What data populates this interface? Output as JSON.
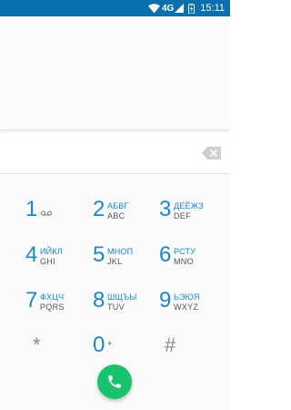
{
  "status_bar": {
    "network": "4G",
    "time": "15:11",
    "color": "#0a6fad",
    "icons": [
      "wifi-icon",
      "signal-icon",
      "battery-icon"
    ]
  },
  "dialpad": {
    "number": "",
    "accent_color": "#1a87c9",
    "call_button_color": "#19c36e",
    "keys": [
      {
        "digit": "1",
        "cyr": "",
        "lat": "",
        "icon": "voicemail-icon"
      },
      {
        "digit": "2",
        "cyr": "АБВГ",
        "lat": "ABC"
      },
      {
        "digit": "3",
        "cyr": "ДЕЁЖЗ",
        "lat": "DEF"
      },
      {
        "digit": "4",
        "cyr": "ИЙКЛ",
        "lat": "GHI"
      },
      {
        "digit": "5",
        "cyr": "МНОП",
        "lat": "JKL"
      },
      {
        "digit": "6",
        "cyr": "РСТУ",
        "lat": "MNO"
      },
      {
        "digit": "7",
        "cyr": "ФХЦЧ",
        "lat": "PQRS"
      },
      {
        "digit": "8",
        "cyr": "ШЩЪЫ",
        "lat": "TUV"
      },
      {
        "digit": "9",
        "cyr": "ЬЭЮЯ",
        "lat": "WXYZ"
      },
      {
        "digit": "*",
        "cyr": "",
        "lat": ""
      },
      {
        "digit": "0",
        "cyr": "",
        "lat": "+"
      },
      {
        "digit": "#",
        "cyr": "",
        "lat": ""
      }
    ]
  }
}
